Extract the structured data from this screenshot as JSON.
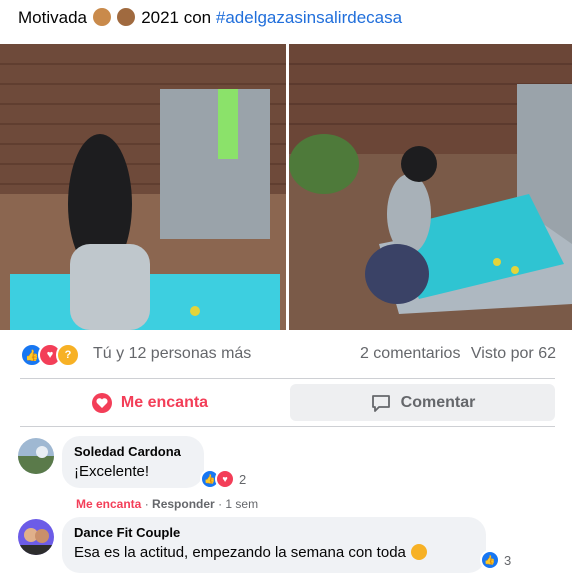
{
  "post": {
    "caption_text": "Motivada",
    "caption_emojis": [
      "flexed-biceps-icon",
      "see-no-evil-monkey-icon"
    ],
    "caption_year": "2021 con",
    "hashtag": "#adelgazasinsalirdecasa"
  },
  "photos": [
    {
      "name": "photo-exercise-back-view"
    },
    {
      "name": "photo-exercise-squat"
    }
  ],
  "reactions": {
    "icons": [
      "like-icon",
      "love-icon",
      "thinking-icon"
    ],
    "summary": "Tú y 12 personas más",
    "comments_count": "2 comentarios",
    "seen_by": "Visto por 62"
  },
  "actions": {
    "love_label": "Me encanta",
    "comment_label": "Comentar"
  },
  "comments": [
    {
      "author": "Soledad Cardona",
      "text": "¡Excelente!",
      "reaction_count": "2",
      "meta_loved": "Me encanta",
      "meta_reply": "Responder",
      "meta_time": "1 sem"
    },
    {
      "author": "Dance Fit Couple",
      "text": "Esa es la actitud, empezando la semana con toda",
      "reaction_count": "3"
    }
  ],
  "colors": {
    "like_blue": "#1877f2",
    "love_red": "#f33e58",
    "hashtag_blue": "#216fdb",
    "mat_teal": "#2ec5d3"
  }
}
